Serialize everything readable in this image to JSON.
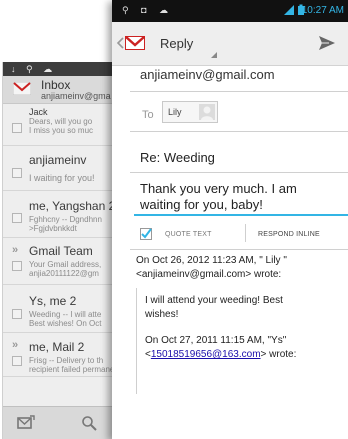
{
  "inbox": {
    "title": "Inbox",
    "account": "anjiameinv@gma",
    "messages": [
      {
        "sender": "Jack",
        "snippet1": "Dears, will you go",
        "snippet2": "I miss you so muc"
      },
      {
        "sender": "anjiameinv",
        "snippet1": "I waiting for you!"
      },
      {
        "sender": "me, Yangshan 2",
        "snippet1": "Fghhcny -- Dgndhnn",
        "snippet2": ">Fgjdvbnkkdt"
      },
      {
        "marker": "»",
        "sender": "Gmail Team",
        "snippet1": "Your Gmail address,",
        "snippet2": "anjia20111122@gm"
      },
      {
        "sender": "Ys, me 2",
        "snippet1": "Weeding -- I will atte",
        "snippet2": "Best wishes! On Oct"
      },
      {
        "marker": "»",
        "sender": "me, Mail 2",
        "snippet1": "Frisg -- Delivery to th",
        "snippet2": "recipient failed permanently:"
      }
    ]
  },
  "reply": {
    "time": "10:27 AM",
    "title": "Reply",
    "from_account": "anjiameinv@gmail.com",
    "to_label": "To",
    "recipient": "Lily",
    "subject": "Re: Weeding",
    "body_line1": "Thank you very much. I am",
    "body_line2": "waiting for you, baby!",
    "quote_text_label": "QUOTE TEXT",
    "respond_inline_label": "RESPOND INLINE",
    "quoted": {
      "line1": "On Oct 26, 2012 11:23 AM, \" Lily \"",
      "line2": "<anjiameinv@gmail.com> wrote:",
      "line3": "I will attend your weeding! Best",
      "line4": "wishes!",
      "line5": "On Oct 27, 2011 11:15 AM, \"Ys\"",
      "line6_link": "15018519656@163.com",
      "line6_lt": "<",
      "line6_rest": "> wrote:"
    }
  },
  "colors": {
    "accent": "#33b5e5",
    "gmail_red": "#cc2222",
    "link": "#1a0dab"
  }
}
